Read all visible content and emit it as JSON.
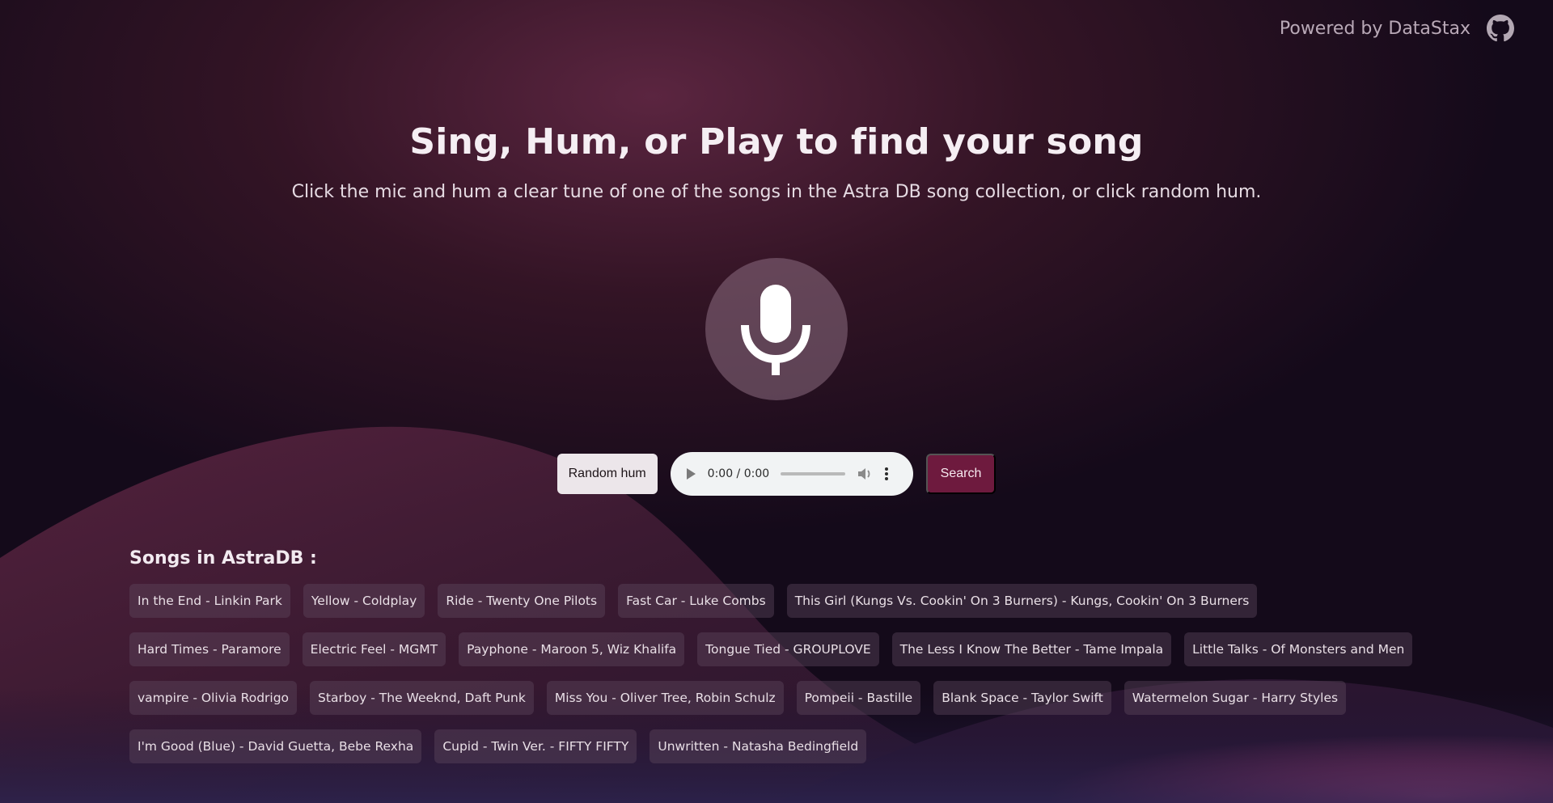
{
  "header": {
    "powered_by": "Powered by DataStax",
    "github_icon": "github-icon"
  },
  "hero": {
    "title": "Sing, Hum, or Play to find your song",
    "subtitle": "Click the mic and hum a clear tune of one of the songs in the Astra DB song collection, or click random hum."
  },
  "mic": {
    "icon": "microphone-icon"
  },
  "controls": {
    "random_label": "Random hum",
    "player_time": "0:00 / 0:00",
    "search_label": "Search"
  },
  "songs": {
    "heading": "Songs in AstraDB :",
    "items": [
      "In the End - Linkin Park",
      "Yellow - Coldplay",
      "Ride - Twenty One Pilots",
      "Fast Car - Luke Combs",
      "This Girl (Kungs Vs. Cookin' On 3 Burners) - Kungs, Cookin' On 3 Burners",
      "Hard Times - Paramore",
      "Electric Feel - MGMT",
      "Payphone - Maroon 5, Wiz Khalifa",
      "Tongue Tied - GROUPLOVE",
      "The Less I Know The Better - Tame Impala",
      "Little Talks - Of Monsters and Men",
      "vampire - Olivia Rodrigo",
      "Starboy - The Weeknd, Daft Punk",
      "Miss You - Oliver Tree, Robin Schulz",
      "Pompeii - Bastille",
      "Blank Space - Taylor Swift",
      "Watermelon Sugar - Harry Styles",
      "I'm Good (Blue) - David Guetta, Bebe Rexha",
      "Cupid - Twin Ver. - FIFTY FIFTY",
      "Unwritten - Natasha Bedingfield"
    ]
  },
  "colors": {
    "background": "#140a1a",
    "wave": "#c2477d",
    "search_button": "#6e1a3e",
    "chip": "#5f4b5f"
  }
}
